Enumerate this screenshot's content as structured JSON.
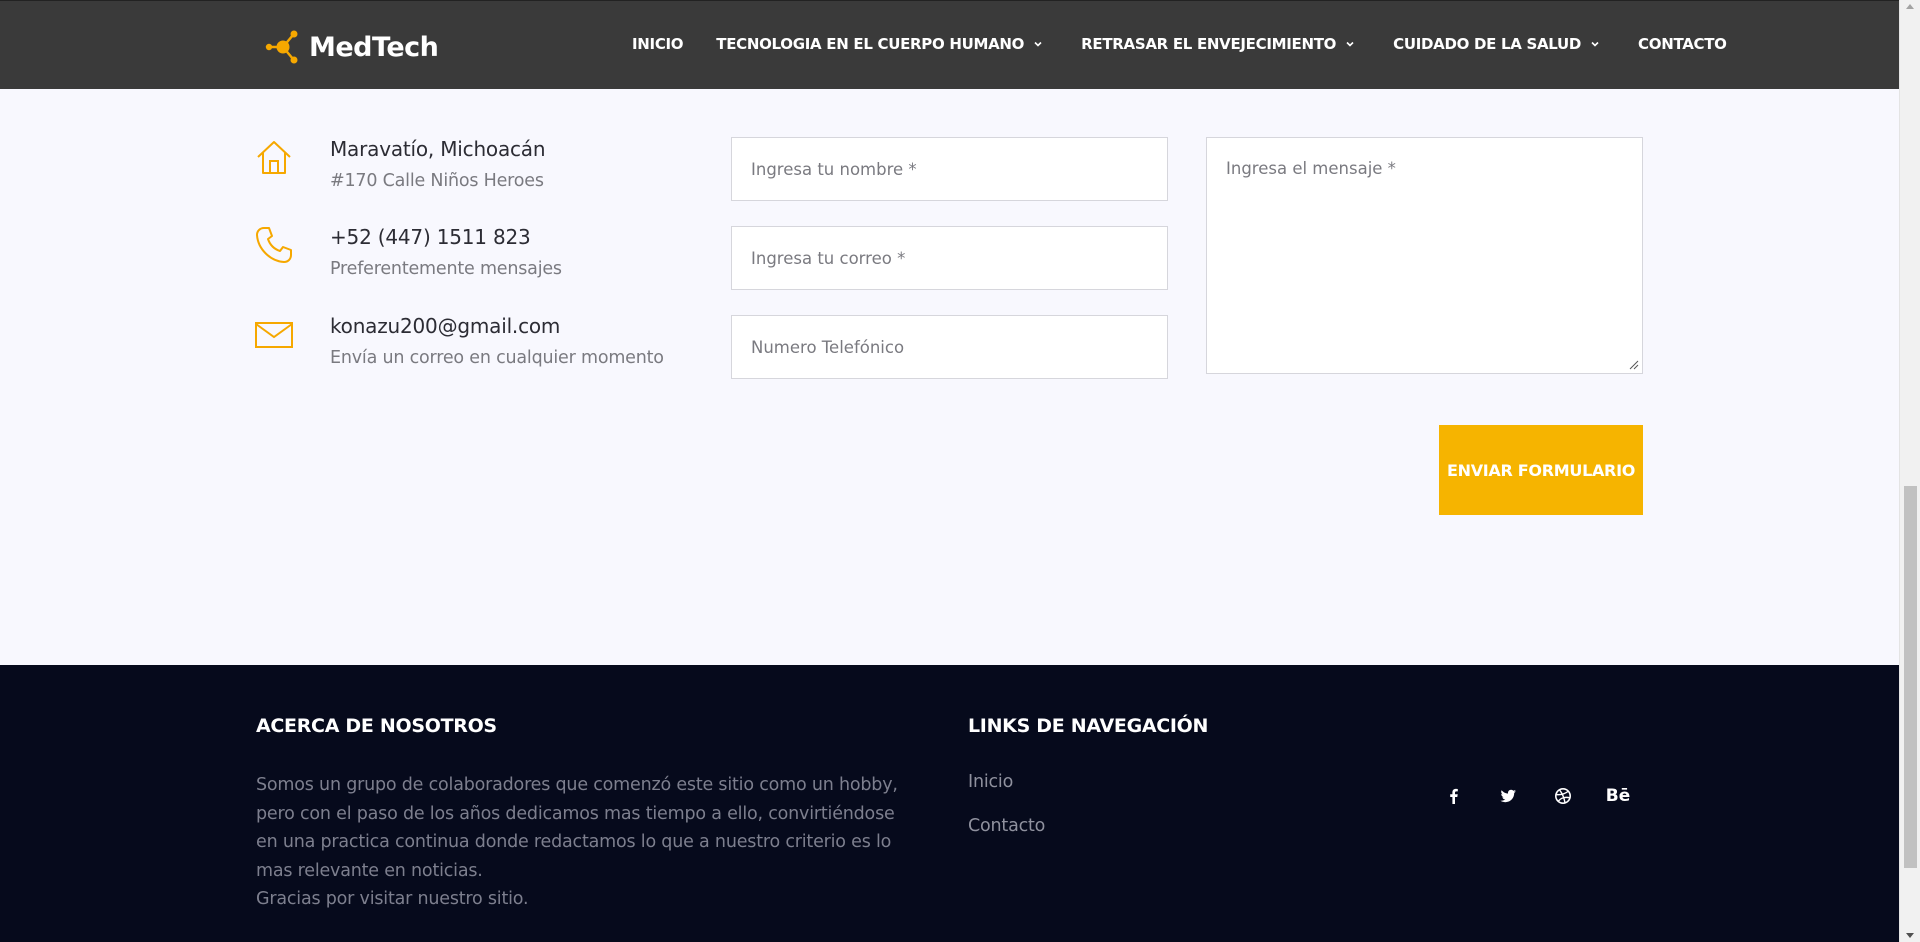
{
  "header": {
    "logo_text": "MedTech",
    "nav": [
      {
        "label": "INICIO",
        "has_dropdown": false
      },
      {
        "label": "TECNOLOGIA EN EL CUERPO HUMANO",
        "has_dropdown": true
      },
      {
        "label": "RETRASAR EL ENVEJECIMIENTO",
        "has_dropdown": true
      },
      {
        "label": "CUIDADO DE LA SALUD",
        "has_dropdown": true
      },
      {
        "label": "CONTACTO",
        "has_dropdown": false
      }
    ]
  },
  "contact_info": [
    {
      "icon": "home-icon",
      "title": "Maravatío, Michoacán",
      "subtitle": "#170 Calle Niños Heroes"
    },
    {
      "icon": "phone-icon",
      "title": "+52 (447) 1511 823",
      "subtitle": "Preferentemente mensajes"
    },
    {
      "icon": "mail-icon",
      "title": "konazu200@gmail.com",
      "subtitle": "Envía un correo en cualquier momento"
    }
  ],
  "form": {
    "name_placeholder": "Ingresa tu nombre *",
    "email_placeholder": "Ingresa tu correo *",
    "phone_placeholder": "Numero Telefónico",
    "message_placeholder": "Ingresa el mensaje *",
    "submit_label": "ENVIAR FORMULARIO"
  },
  "footer": {
    "about_heading": "ACERCA DE NOSOTROS",
    "about_text": "Somos un grupo de colaboradores que comenzó este sitio como un hobby, pero con el paso de los años dedicamos mas tiempo a ello, convirtiéndose en una practica continua donde redactamos lo que a nuestro criterio es lo mas relevante en noticias.",
    "about_thanks": "Gracias por visitar nuestro sitio.",
    "links_heading": "LINKS DE NAVEGACIÓN",
    "links": [
      "Inicio",
      "Contacto"
    ],
    "social": [
      "facebook-icon",
      "twitter-icon",
      "dribbble-icon",
      "behance-icon"
    ],
    "behance_label": "Bē"
  },
  "colors": {
    "accent": "#f6b400",
    "header_bg": "#3a3a3a",
    "footer_bg": "#060a1c",
    "page_bg": "#f8f8fe"
  }
}
